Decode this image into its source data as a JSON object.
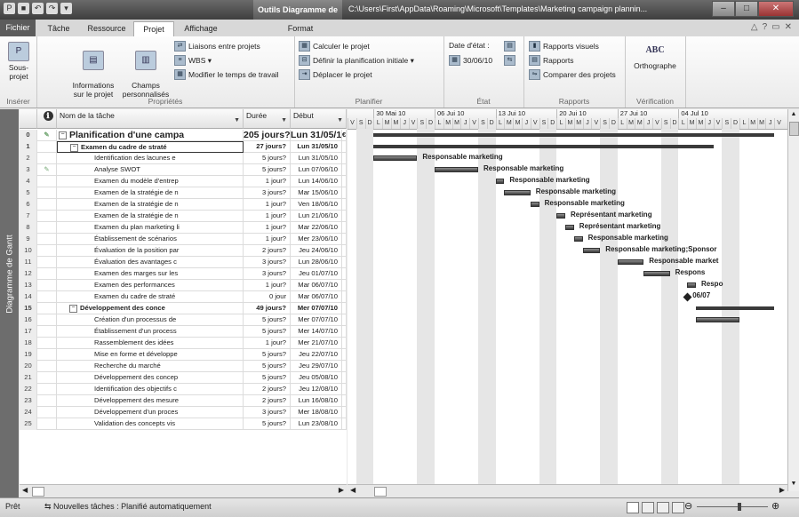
{
  "app": {
    "context_tab_title": "Outils Diagramme de Gantt",
    "window_title": "C:\\Users\\First\\AppData\\Roaming\\Microsoft\\Templates\\Marketing campaign plannin...",
    "window_buttons": [
      "–",
      "□",
      "✕"
    ]
  },
  "tabs": [
    "Fichier",
    "Tâche",
    "Ressource",
    "Projet",
    "Affichage",
    "Format"
  ],
  "active_tab": "Projet",
  "ribbon": {
    "groups": {
      "inserer": "Insérer",
      "proprietes": "Propriétés",
      "planifier": "Planifier",
      "etat": "État",
      "rapports": "Rapports",
      "verification": "Vérification"
    },
    "sous_projet": "Sous-projet",
    "informations": "Informations\nsur le projet",
    "champs": "Champs\npersonnalisés",
    "liaisons": "Liaisons entre projets",
    "wbs": "WBS ▾",
    "modifier_temps": "Modifier le temps de travail",
    "calculer": "Calculer le projet",
    "definir": "Définir la planification initiale ▾",
    "deplacer": "Déplacer le projet",
    "date_etat_label": "Date d'état :",
    "date_etat_value": "30/06/10",
    "rapports_visuels": "Rapports visuels",
    "rapports": "Rapports",
    "comparer": "Comparer des projets",
    "orthographe": "Orthographe",
    "abc": "ABC"
  },
  "side_label": "Diagramme de Gantt",
  "table": {
    "headers": {
      "id": "",
      "indicator": "ℹ",
      "name": "Nom de la tâche",
      "duration": "Durée",
      "start": "Début"
    },
    "rows": [
      {
        "id": "0",
        "ind": "✎",
        "name": "Planification d'une campa",
        "dur": "205 jours?",
        "start": "Lun 31/05/10",
        "ext": "€",
        "level": 0,
        "summary": true
      },
      {
        "id": "1",
        "ind": "",
        "name": "Examen du cadre de straté",
        "dur": "27 jours?",
        "start": "Lun 31/05/10",
        "ext": "",
        "level": 1,
        "summary": true,
        "selected": true
      },
      {
        "id": "2",
        "ind": "",
        "name": "Identification des lacunes e",
        "dur": "5 jours?",
        "start": "Lun 31/05/10",
        "ext": "",
        "level": 2
      },
      {
        "id": "3",
        "ind": "✎",
        "name": "Analyse SWOT",
        "dur": "5 jours?",
        "start": "Lun 07/06/10",
        "ext": "",
        "level": 2
      },
      {
        "id": "4",
        "ind": "",
        "name": "Examen du modèle d'entrep",
        "dur": "1 jour?",
        "start": "Lun 14/06/10",
        "ext": "",
        "level": 2
      },
      {
        "id": "5",
        "ind": "",
        "name": "Examen de la stratégie de n",
        "dur": "3 jours?",
        "start": "Mar 15/06/10",
        "ext": "",
        "level": 2
      },
      {
        "id": "6",
        "ind": "",
        "name": "Examen de la stratégie de n",
        "dur": "1 jour?",
        "start": "Ven 18/06/10",
        "ext": "",
        "level": 2
      },
      {
        "id": "7",
        "ind": "",
        "name": "Examen de la stratégie de n",
        "dur": "1 jour?",
        "start": "Lun 21/06/10",
        "ext": "",
        "level": 2
      },
      {
        "id": "8",
        "ind": "",
        "name": "Examen du plan marketing li",
        "dur": "1 jour?",
        "start": "Mar 22/06/10",
        "ext": "",
        "level": 2
      },
      {
        "id": "9",
        "ind": "",
        "name": "Établissement de scénarios",
        "dur": "1 jour?",
        "start": "Mer 23/06/10",
        "ext": "",
        "level": 2
      },
      {
        "id": "10",
        "ind": "",
        "name": "Évaluation de la position par",
        "dur": "2 jours?",
        "start": "Jeu 24/06/10",
        "ext": "",
        "level": 2
      },
      {
        "id": "11",
        "ind": "",
        "name": "Évaluation des avantages c",
        "dur": "3 jours?",
        "start": "Lun 28/06/10",
        "ext": "",
        "level": 2
      },
      {
        "id": "12",
        "ind": "",
        "name": "Examen des marges sur les",
        "dur": "3 jours?",
        "start": "Jeu 01/07/10",
        "ext": "",
        "level": 2
      },
      {
        "id": "13",
        "ind": "",
        "name": "Examen des performances",
        "dur": "1 jour?",
        "start": "Mar 06/07/10",
        "ext": "",
        "level": 2
      },
      {
        "id": "14",
        "ind": "",
        "name": "Examen du cadre de straté",
        "dur": "0 jour",
        "start": "Mar 06/07/10",
        "ext": "",
        "level": 2
      },
      {
        "id": "15",
        "ind": "",
        "name": "Développement des conce",
        "dur": "49 jours?",
        "start": "Mer 07/07/10",
        "ext": "",
        "level": 1,
        "summary": true
      },
      {
        "id": "16",
        "ind": "",
        "name": "Création d'un processus de",
        "dur": "5 jours?",
        "start": "Mer 07/07/10",
        "ext": "",
        "level": 2
      },
      {
        "id": "17",
        "ind": "",
        "name": "Établissement d'un process",
        "dur": "5 jours?",
        "start": "Mer 14/07/10",
        "ext": "",
        "level": 2
      },
      {
        "id": "18",
        "ind": "",
        "name": "Rassemblement des idées",
        "dur": "1 jour?",
        "start": "Mer 21/07/10",
        "ext": "",
        "level": 2
      },
      {
        "id": "19",
        "ind": "",
        "name": "Mise en forme et développe",
        "dur": "5 jours?",
        "start": "Jeu 22/07/10",
        "ext": "",
        "level": 2
      },
      {
        "id": "20",
        "ind": "",
        "name": "Recherche du marché",
        "dur": "5 jours?",
        "start": "Jeu 29/07/10",
        "ext": "",
        "level": 2
      },
      {
        "id": "21",
        "ind": "",
        "name": "Développement des concep",
        "dur": "5 jours?",
        "start": "Jeu 05/08/10",
        "ext": "",
        "level": 2
      },
      {
        "id": "22",
        "ind": "",
        "name": "Identification des objectifs c",
        "dur": "2 jours?",
        "start": "Jeu 12/08/10",
        "ext": "",
        "level": 2
      },
      {
        "id": "23",
        "ind": "",
        "name": "Développement des mesure",
        "dur": "2 jours?",
        "start": "Lun 16/08/10",
        "ext": "",
        "level": 2
      },
      {
        "id": "24",
        "ind": "",
        "name": "Développement d'un proces",
        "dur": "3 jours?",
        "start": "Mer 18/08/10",
        "ext": "",
        "level": 2
      },
      {
        "id": "25",
        "ind": "",
        "name": "Validation des concepts vis",
        "dur": "5 jours?",
        "start": "Lun 23/08/10",
        "ext": "",
        "level": 2
      }
    ]
  },
  "gantt": {
    "weeks": [
      "30 Mai 10",
      "06 Jui 10",
      "13 Jui 10",
      "20 Jui 10",
      "27 Jui 10",
      "04 Jul 10"
    ],
    "days": [
      "V",
      "S",
      "D",
      "L",
      "M",
      "M",
      "J",
      "V",
      "S",
      "D",
      "L",
      "M",
      "M",
      "J",
      "V",
      "S",
      "D",
      "L",
      "M",
      "M",
      "J",
      "V",
      "S",
      "D",
      "L",
      "M",
      "M",
      "J",
      "V",
      "S",
      "D",
      "L",
      "M",
      "M",
      "J",
      "V",
      "S",
      "D",
      "L",
      "M",
      "M",
      "J",
      "V",
      "S",
      "D",
      "L",
      "M",
      "M",
      "J",
      "V"
    ],
    "resources": {
      "2": "Responsable marketing",
      "3": "Responsable marketing",
      "4": "Responsable marketing",
      "5": "Responsable marketing",
      "6": "Responsable marketing",
      "7": "Représentant marketing",
      "8": "Représentant marketing",
      "9": "Responsable marketing",
      "10": "Responsable marketing;Sponsor",
      "11": "Responsable market",
      "12": "Respons",
      "13": "Respo",
      "14": "06/07"
    }
  },
  "status": {
    "ready": "Prêt",
    "mode": "Nouvelles tâches : Planifié automatiquement"
  }
}
